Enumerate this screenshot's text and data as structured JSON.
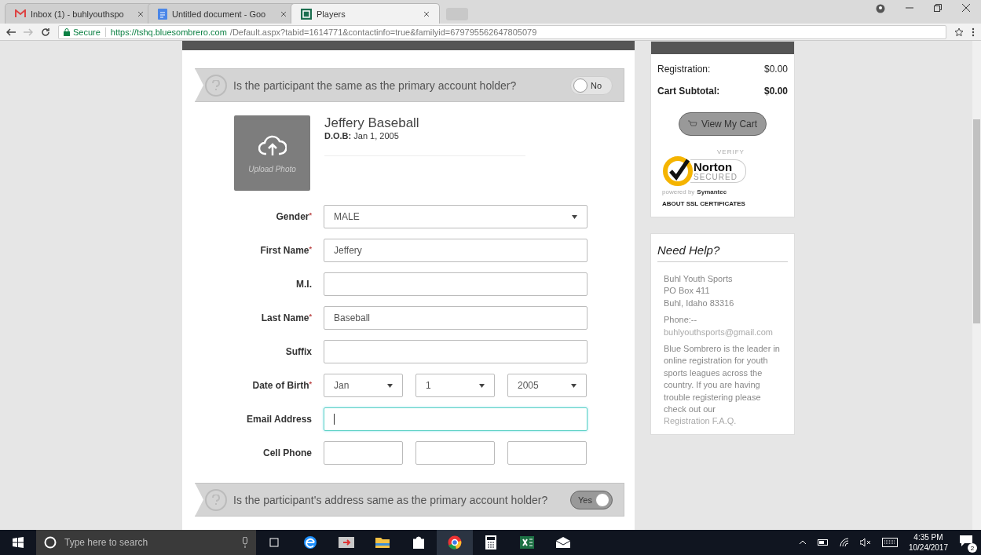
{
  "browser": {
    "tabs": [
      {
        "title": "Inbox (1) - buhlyouthspo",
        "kind": "mail",
        "selected": false
      },
      {
        "title": "Untitled document - Goo",
        "kind": "doc",
        "selected": false
      },
      {
        "title": "Players",
        "kind": "hq",
        "selected": true
      }
    ],
    "address": {
      "secure_label": "Secure",
      "host": "https://tshq.bluesombrero.com",
      "path": "/Default.aspx?tabid=1614771&contactinfo=true&familyid=679795562647805079"
    }
  },
  "form": {
    "questions": [
      {
        "text": "Is the participant the same as the primary account holder?",
        "toggle_label": "No",
        "on": false
      },
      {
        "text": "Is the participant's address same as the primary account holder?",
        "toggle_label": "Yes",
        "on": true
      }
    ],
    "participant": {
      "name": "Jeffery Baseball",
      "dob_label": "D.O.B:",
      "dob_value": "Jan 1, 2005",
      "upload_label": "Upload Photo"
    },
    "fields": [
      {
        "label": "Gender",
        "required_mark": "*",
        "kind": "select",
        "value": "MALE",
        "focused": false
      },
      {
        "label": "First Name",
        "required_mark": "*",
        "kind": "text",
        "value": "Jeffery",
        "focused": false
      },
      {
        "label": "M.I.",
        "kind": "text",
        "focused": false
      },
      {
        "label": "Last Name",
        "required_mark": "*",
        "kind": "text",
        "value": "Baseball",
        "focused": false
      },
      {
        "label": "Suffix",
        "kind": "text",
        "focused": false
      },
      {
        "label": "Date of Birth",
        "required_mark": "*",
        "kind": "date",
        "parts": [
          "Jan",
          "1",
          "2005"
        ],
        "focused": false
      },
      {
        "label": "Email Address",
        "kind": "text",
        "focused": true
      },
      {
        "label": "Cell Phone",
        "kind": "phone",
        "focused": false
      }
    ]
  },
  "cart": {
    "rows": [
      {
        "label": "Registration:",
        "amount": "$0.00",
        "kind": "line"
      },
      {
        "label": "Cart Subtotal:",
        "amount": "$0.00",
        "kind": "total"
      }
    ],
    "button": "View My Cart",
    "seal": {
      "verify": "VERIFY",
      "brand": "Norton",
      "secured": "SECURED",
      "powered": "powered by",
      "company": "Symantec",
      "about": "ABOUT SSL CERTIFICATES"
    }
  },
  "help": {
    "title": "Need Help?",
    "address": [
      "Buhl Youth Sports",
      "PO Box 411",
      "Buhl, Idaho 83316"
    ],
    "phone": "Phone:--",
    "email": "buhlyouthsports@gmail.com",
    "about": "Blue Sombrero is the leader in online registration for youth sports leagues across the country. If you are having trouble registering please check out our",
    "link": "Registration F.A.Q."
  },
  "taskbar": {
    "search_placeholder": "Type here to search",
    "time": "4:35 PM",
    "date": "10/24/2017",
    "notifications": "2"
  }
}
